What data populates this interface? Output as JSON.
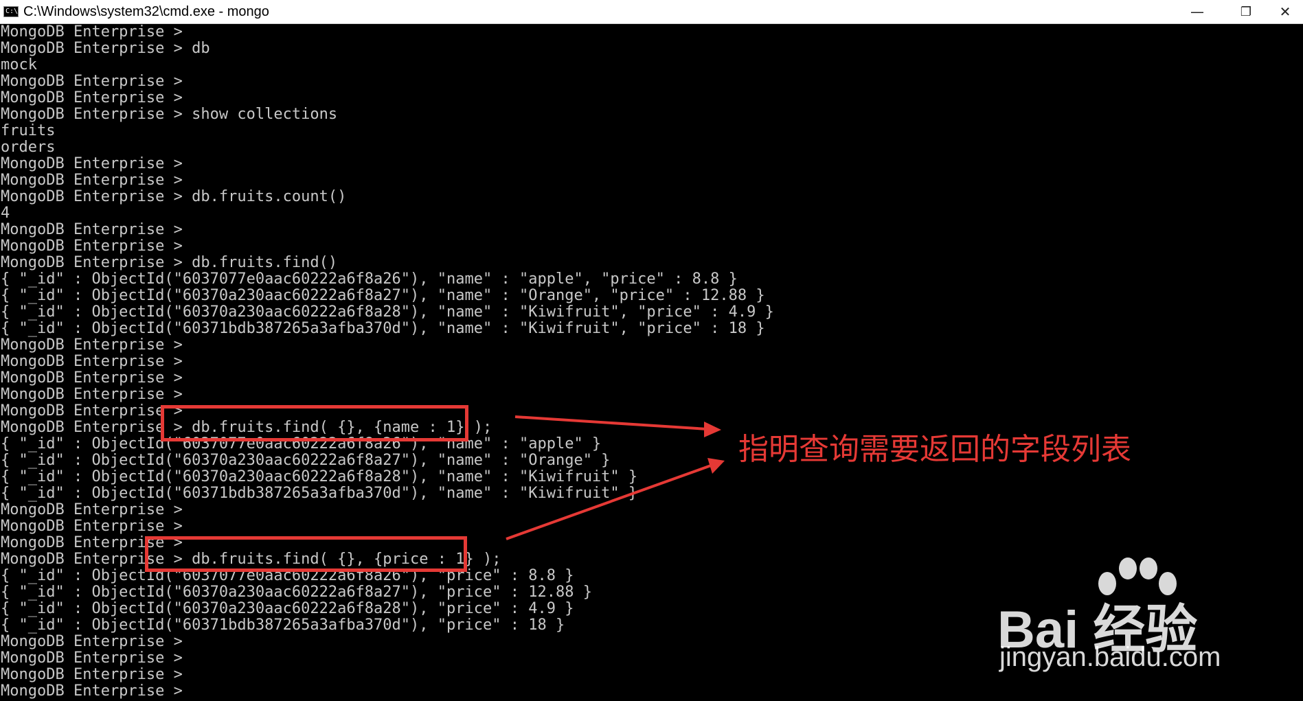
{
  "window": {
    "title": "C:\\Windows\\system32\\cmd.exe - mongo",
    "icon_label": "C:\\",
    "minimize_glyph": "—",
    "restore_glyph": "❐",
    "close_glyph": "✕"
  },
  "console": {
    "lines": [
      "MongoDB Enterprise >",
      "MongoDB Enterprise > db",
      "mock",
      "MongoDB Enterprise >",
      "MongoDB Enterprise >",
      "MongoDB Enterprise > show collections",
      "fruits",
      "orders",
      "MongoDB Enterprise >",
      "MongoDB Enterprise >",
      "MongoDB Enterprise > db.fruits.count()",
      "4",
      "MongoDB Enterprise >",
      "MongoDB Enterprise >",
      "MongoDB Enterprise > db.fruits.find()",
      "{ \"_id\" : ObjectId(\"6037077e0aac60222a6f8a26\"), \"name\" : \"apple\", \"price\" : 8.8 }",
      "{ \"_id\" : ObjectId(\"60370a230aac60222a6f8a27\"), \"name\" : \"Orange\", \"price\" : 12.88 }",
      "{ \"_id\" : ObjectId(\"60370a230aac60222a6f8a28\"), \"name\" : \"Kiwifruit\", \"price\" : 4.9 }",
      "{ \"_id\" : ObjectId(\"60371bdb387265a3afba370d\"), \"name\" : \"Kiwifruit\", \"price\" : 18 }",
      "MongoDB Enterprise >",
      "MongoDB Enterprise >",
      "MongoDB Enterprise >",
      "MongoDB Enterprise >",
      "MongoDB Enterprise >",
      "MongoDB Enterprise > db.fruits.find( {}, {name : 1} );",
      "{ \"_id\" : ObjectId(\"6037077e0aac60222a6f8a26\"), \"name\" : \"apple\" }",
      "{ \"_id\" : ObjectId(\"60370a230aac60222a6f8a27\"), \"name\" : \"Orange\" }",
      "{ \"_id\" : ObjectId(\"60370a230aac60222a6f8a28\"), \"name\" : \"Kiwifruit\" }",
      "{ \"_id\" : ObjectId(\"60371bdb387265a3afba370d\"), \"name\" : \"Kiwifruit\" }",
      "MongoDB Enterprise >",
      "MongoDB Enterprise >",
      "MongoDB Enterprise >",
      "MongoDB Enterprise > db.fruits.find( {}, {price : 1} );",
      "{ \"_id\" : ObjectId(\"6037077e0aac60222a6f8a26\"), \"price\" : 8.8 }",
      "{ \"_id\" : ObjectId(\"60370a230aac60222a6f8a27\"), \"price\" : 12.88 }",
      "{ \"_id\" : ObjectId(\"60370a230aac60222a6f8a28\"), \"price\" : 4.9 }",
      "{ \"_id\" : ObjectId(\"60371bdb387265a3afba370d\"), \"price\" : 18 }",
      "MongoDB Enterprise >",
      "MongoDB Enterprise >",
      "MongoDB Enterprise >",
      "MongoDB Enterprise >"
    ]
  },
  "annotation": {
    "text": "指明查询需要返回的字段列表",
    "color": "#e53935"
  },
  "watermark": {
    "logo_text": "Bai 经验",
    "url": "jingyan.baidu.com"
  },
  "colors": {
    "background": "#000000",
    "console_text": "#c8c8c8",
    "titlebar": "#ffffff"
  }
}
